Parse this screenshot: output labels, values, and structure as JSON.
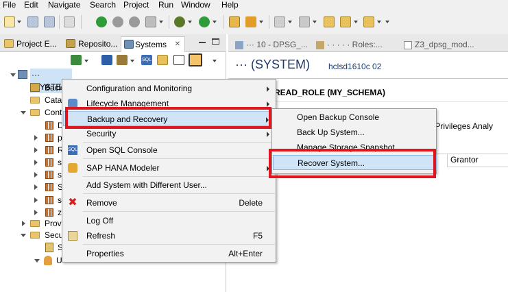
{
  "menubar": {
    "items": [
      "File",
      "Edit",
      "Navigate",
      "Search",
      "Project",
      "Run",
      "Window",
      "Help"
    ]
  },
  "left_tabs": [
    {
      "label": "Project E...",
      "icon": "project-explorer-icon"
    },
    {
      "label": "Reposito...",
      "icon": "repository-icon"
    },
    {
      "label": "Systems",
      "icon": "systems-icon",
      "close": "✕"
    }
  ],
  "tree": {
    "root_label": "··· (SYSTEM)",
    "nodes": [
      "Back",
      "Cata",
      "Cont",
      "D",
      "p",
      "R",
      "s",
      "s",
      "S",
      "sy",
      "z",
      "Prov",
      "Secu",
      "S",
      "U"
    ]
  },
  "right_tabs": [
    "··· 10 - DPSG_...",
    "· · · · · Roles:...",
    "Z3_dpsg_mod..."
  ],
  "editor": {
    "system_title": "··· (SYSTEM)",
    "host": "hclsd1610c 02",
    "role_title": "READ_ROLE (MY_SCHEMA)",
    "subtabs": "ect Privileges  Analy",
    "grantor_header": "Grantor"
  },
  "context_menu": {
    "items": [
      {
        "label": "Configuration and Monitoring",
        "submenu": true
      },
      {
        "label": "Lifecycle Management",
        "submenu": true,
        "icon": "lifecycle-icon"
      },
      {
        "label": "Backup and Recovery",
        "submenu": true
      },
      {
        "label": "Security",
        "submenu": true
      },
      {
        "label": "Open SQL Console",
        "icon": "sql-icon"
      },
      {
        "label": "SAP HANA Modeler",
        "submenu": true,
        "icon": "modeler-icon"
      },
      {
        "label": "Add System with Different User..."
      },
      {
        "label": "Remove",
        "shortcut": "Delete",
        "icon": "remove-icon"
      },
      {
        "label": "Log Off"
      },
      {
        "label": "Refresh",
        "shortcut": "F5",
        "icon": "refresh-icon"
      },
      {
        "label": "Properties",
        "shortcut": "Alt+Enter"
      }
    ]
  },
  "submenu": {
    "items": [
      {
        "label": "Open Backup Console"
      },
      {
        "label": "Back Up System..."
      },
      {
        "label": "Manage Storage Snapshot"
      },
      {
        "label": "Recover System..."
      }
    ]
  },
  "colors": {
    "highlight_red": "#e0161f",
    "menu_hover": "#d1e4f5",
    "title_blue": "#1c3a6b"
  }
}
